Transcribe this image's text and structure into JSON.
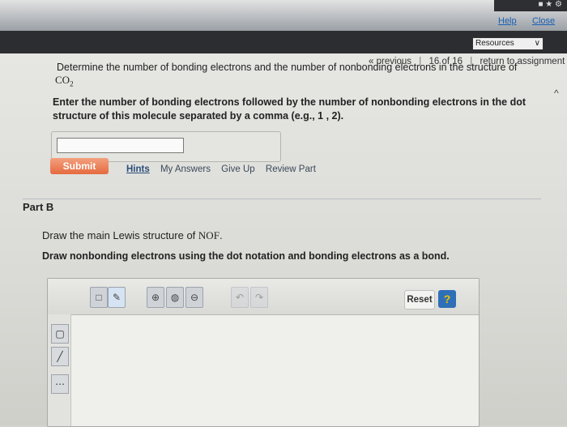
{
  "header": {
    "help_label": "Help",
    "close_label": "Close",
    "resources_label": "Resources"
  },
  "pager": {
    "previous_label": "« previous",
    "position": "16 of 16",
    "return_label": "return to assignment"
  },
  "part_a": {
    "question": "Determine the number of bonding electrons and the number of nonbonding electrons in the structure of",
    "formula_base": "CO",
    "formula_sub": "2",
    "instruction": "Enter the number of bonding electrons followed by the number of nonbonding electrons in the dot structure of this molecule separated by a comma (e.g., 1 , 2).",
    "answer_value": "",
    "submit_label": "Submit",
    "links": {
      "hints": "Hints",
      "my_answers": "My Answers",
      "give_up": "Give Up",
      "review_part": "Review Part"
    }
  },
  "part_b": {
    "title": "Part B",
    "prompt_prefix": "Draw the main Lewis structure of",
    "molecule": "NOF",
    "prompt_suffix": ".",
    "instruction": "Draw nonbonding electrons using the dot notation and bonding electrons as a bond.",
    "editor": {
      "reset_label": "Reset",
      "help_label": "?"
    }
  },
  "colors": {
    "submit": "#e56a3e",
    "help_button": "#2e6fb8",
    "nav_bar": "#2b2d30"
  }
}
